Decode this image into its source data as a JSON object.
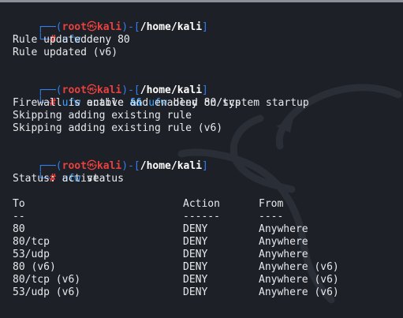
{
  "prompt": {
    "corner_top": "┌──(",
    "user": "root",
    "skull": "㉿",
    "host": "kali",
    "sep": ")-[",
    "path": "/home/kali",
    "close": "]",
    "corner_bottom": "└─",
    "hash": "#"
  },
  "blocks": [
    {
      "command": {
        "cmd": "ufw",
        "args": " deny 80"
      },
      "output": [
        "Rule updated",
        "Rule updated (v6)"
      ]
    },
    {
      "command": {
        "cmd": "ufw",
        "args": " enable ",
        "op": "&&",
        "cmd2": "ufw",
        "args2": " deny 80/tcp"
      },
      "output": [
        "Firewall is active and enabled on system startup",
        "Skipping adding existing rule",
        "Skipping adding existing rule (v6)"
      ]
    },
    {
      "command": {
        "cmd": "ufw",
        "args": " status"
      },
      "output": [
        "Status: active"
      ]
    }
  ],
  "status_table": {
    "headers": {
      "to": "To",
      "action": "Action",
      "from": "From"
    },
    "underline": {
      "to": "--",
      "action": "------",
      "from": "----"
    },
    "rows": [
      {
        "to": "80",
        "action": "DENY",
        "from": "Anywhere"
      },
      {
        "to": "80/tcp",
        "action": "DENY",
        "from": "Anywhere"
      },
      {
        "to": "53/udp",
        "action": "DENY",
        "from": "Anywhere"
      },
      {
        "to": "80 (v6)",
        "action": "DENY",
        "from": "Anywhere (v6)"
      },
      {
        "to": "80/tcp (v6)",
        "action": "DENY",
        "from": "Anywhere (v6)"
      },
      {
        "to": "53/udp (v6)",
        "action": "DENY",
        "from": "Anywhere (v6)"
      }
    ]
  }
}
